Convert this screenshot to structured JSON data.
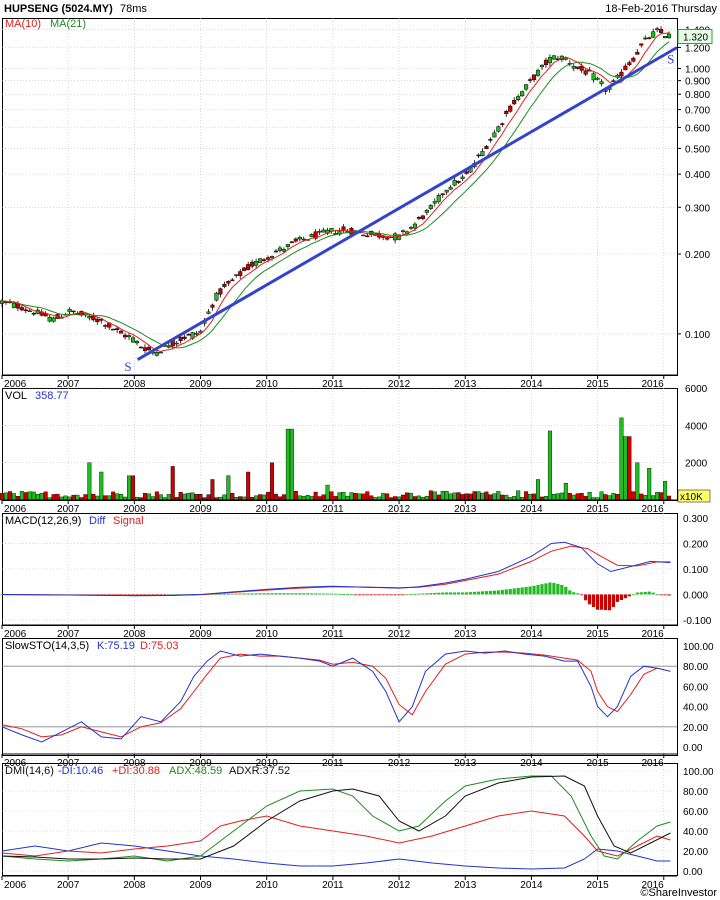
{
  "header": {
    "symbol": "HUPSENG (5024.MY)",
    "timing": "78ms",
    "date": "18-Feb-2016 Thursday",
    "copyright": "©ShareInvestor"
  },
  "colors": {
    "up": "#22bb22",
    "down": "#cc0000",
    "trendline": "#3344cc",
    "ma10": "#e02020",
    "ma21": "#208a20",
    "macd_diff": "#2233cc",
    "macd_signal": "#e02020",
    "sto_k": "#2233cc",
    "sto_d": "#e02020",
    "dmi_minus": "#2233cc",
    "dmi_plus": "#e02020",
    "adx": "#208a20",
    "adxr": "#111111",
    "grid": "#c0c0c0",
    "guide": "#888888"
  },
  "x_axis": {
    "year_labels": [
      "2006",
      "2007",
      "2008",
      "2009",
      "2010",
      "2011",
      "2012",
      "2013",
      "2014",
      "2015",
      "2016"
    ]
  },
  "chart_data": [
    {
      "type": "candlestick",
      "name": "price",
      "legend": [
        {
          "label": "MA(10)",
          "color": "#e02020"
        },
        {
          "label": "MA(21)",
          "color": "#208a20"
        }
      ],
      "y_scale": "log",
      "ylim": [
        0.07,
        1.55
      ],
      "y_ticks": [
        "0.100",
        "0.200",
        "0.300",
        "0.400",
        "0.500",
        "0.600",
        "0.700",
        "0.800",
        "0.900",
        "1.000",
        "1.200",
        "1.400"
      ],
      "last_price": "1.320",
      "trendline_labels": [
        "S",
        "S"
      ],
      "price_path": [
        [
          2006.0,
          0.132
        ],
        [
          2006.3,
          0.126
        ],
        [
          2006.6,
          0.118
        ],
        [
          2006.8,
          0.113
        ],
        [
          2007.0,
          0.122
        ],
        [
          2007.2,
          0.118
        ],
        [
          2007.5,
          0.112
        ],
        [
          2007.8,
          0.1
        ],
        [
          2007.95,
          0.097
        ],
        [
          2008.1,
          0.09
        ],
        [
          2008.3,
          0.085
        ],
        [
          2008.5,
          0.09
        ],
        [
          2008.75,
          0.097
        ],
        [
          2009.0,
          0.102
        ],
        [
          2009.25,
          0.14
        ],
        [
          2009.5,
          0.16
        ],
        [
          2009.75,
          0.18
        ],
        [
          2010.0,
          0.195
        ],
        [
          2010.25,
          0.21
        ],
        [
          2010.5,
          0.225
        ],
        [
          2010.75,
          0.235
        ],
        [
          2011.0,
          0.245
        ],
        [
          2011.25,
          0.245
        ],
        [
          2011.5,
          0.238
        ],
        [
          2011.75,
          0.235
        ],
        [
          2012.0,
          0.232
        ],
        [
          2012.25,
          0.26
        ],
        [
          2012.5,
          0.3
        ],
        [
          2012.75,
          0.36
        ],
        [
          2013.0,
          0.39
        ],
        [
          2013.25,
          0.48
        ],
        [
          2013.5,
          0.6
        ],
        [
          2013.75,
          0.75
        ],
        [
          2014.0,
          0.9
        ],
        [
          2014.15,
          1.0
        ],
        [
          2014.3,
          1.1
        ],
        [
          2014.5,
          1.1
        ],
        [
          2014.7,
          1.0
        ],
        [
          2014.9,
          0.95
        ],
        [
          2015.0,
          0.9
        ],
        [
          2015.15,
          0.82
        ],
        [
          2015.35,
          0.95
        ],
        [
          2015.55,
          1.1
        ],
        [
          2015.75,
          1.3
        ],
        [
          2015.9,
          1.38
        ],
        [
          2016.1,
          1.32
        ]
      ]
    },
    {
      "type": "bar",
      "name": "volume",
      "legend_label": "VOL",
      "legend_value": "358.77",
      "unit": "x10K",
      "ylim": [
        0,
        6000
      ],
      "y_ticks": [
        "6000",
        "4000",
        "2000"
      ],
      "spikes": [
        [
          2007.3,
          2000
        ],
        [
          2007.5,
          1500
        ],
        [
          2007.95,
          1300
        ],
        [
          2008.6,
          1800
        ],
        [
          2009.2,
          1100
        ],
        [
          2009.4,
          1300
        ],
        [
          2009.7,
          1500
        ],
        [
          2010.1,
          2000
        ],
        [
          2010.35,
          3800
        ],
        [
          2010.9,
          800
        ],
        [
          2011.3,
          400
        ],
        [
          2012.5,
          500
        ],
        [
          2013.2,
          450
        ],
        [
          2013.8,
          500
        ],
        [
          2014.1,
          1100
        ],
        [
          2014.3,
          3700
        ],
        [
          2014.5,
          900
        ],
        [
          2015.35,
          4400
        ],
        [
          2015.45,
          3400
        ],
        [
          2015.6,
          2000
        ],
        [
          2015.8,
          1700
        ],
        [
          2016.0,
          1000
        ]
      ],
      "base_level": 250
    },
    {
      "type": "line",
      "name": "MACD(12,26,9)",
      "legend": [
        {
          "label": "MACD(12,26,9)",
          "color": "#111111"
        },
        {
          "label": "Diff",
          "color": "#2233cc"
        },
        {
          "label": "Signal",
          "color": "#e02020"
        }
      ],
      "ylim": [
        -0.12,
        0.32
      ],
      "y_ticks": [
        "0.300",
        "0.200",
        "0.100",
        "0.000",
        "-0.100"
      ],
      "diff": [
        [
          2006.0,
          0.0
        ],
        [
          2007.0,
          -0.002
        ],
        [
          2008.0,
          -0.005
        ],
        [
          2008.5,
          -0.004
        ],
        [
          2009.0,
          0.0
        ],
        [
          2009.5,
          0.01
        ],
        [
          2010.0,
          0.02
        ],
        [
          2010.5,
          0.028
        ],
        [
          2011.0,
          0.032
        ],
        [
          2011.5,
          0.028
        ],
        [
          2012.0,
          0.025
        ],
        [
          2012.3,
          0.03
        ],
        [
          2012.7,
          0.045
        ],
        [
          2013.0,
          0.06
        ],
        [
          2013.5,
          0.09
        ],
        [
          2014.0,
          0.15
        ],
        [
          2014.3,
          0.2
        ],
        [
          2014.5,
          0.205
        ],
        [
          2014.75,
          0.185
        ],
        [
          2015.0,
          0.12
        ],
        [
          2015.2,
          0.09
        ],
        [
          2015.5,
          0.11
        ],
        [
          2015.8,
          0.13
        ],
        [
          2016.1,
          0.125
        ]
      ],
      "signal": [
        [
          2006.0,
          0.0
        ],
        [
          2007.0,
          -0.002
        ],
        [
          2008.0,
          -0.004
        ],
        [
          2008.5,
          -0.004
        ],
        [
          2009.0,
          -0.001
        ],
        [
          2009.5,
          0.008
        ],
        [
          2010.0,
          0.017
        ],
        [
          2010.5,
          0.025
        ],
        [
          2011.0,
          0.03
        ],
        [
          2011.5,
          0.029
        ],
        [
          2012.0,
          0.026
        ],
        [
          2012.3,
          0.028
        ],
        [
          2012.7,
          0.04
        ],
        [
          2013.0,
          0.055
        ],
        [
          2013.5,
          0.08
        ],
        [
          2014.0,
          0.13
        ],
        [
          2014.3,
          0.17
        ],
        [
          2014.6,
          0.19
        ],
        [
          2014.85,
          0.18
        ],
        [
          2015.05,
          0.15
        ],
        [
          2015.3,
          0.115
        ],
        [
          2015.6,
          0.112
        ],
        [
          2015.9,
          0.128
        ],
        [
          2016.1,
          0.128
        ]
      ]
    },
    {
      "type": "line",
      "name": "SlowSTO(14,3,5)",
      "legend": [
        {
          "label": "SlowSTO(14,3,5)",
          "color": "#111111"
        },
        {
          "label": "K:75.19",
          "color": "#2233cc"
        },
        {
          "label": "D:75.03",
          "color": "#e02020"
        }
      ],
      "ylim": [
        0,
        100
      ],
      "y_ticks": [
        "100.00",
        "80.00",
        "60.00",
        "40.00",
        "20.00",
        "0.00"
      ],
      "guide_levels": [
        80,
        20
      ],
      "k": [
        [
          2006.0,
          20
        ],
        [
          2006.3,
          12
        ],
        [
          2006.6,
          5
        ],
        [
          2006.9,
          15
        ],
        [
          2007.2,
          25
        ],
        [
          2007.5,
          10
        ],
        [
          2007.8,
          8
        ],
        [
          2008.1,
          30
        ],
        [
          2008.4,
          25
        ],
        [
          2008.7,
          45
        ],
        [
          2008.9,
          70
        ],
        [
          2009.1,
          85
        ],
        [
          2009.3,
          95
        ],
        [
          2009.6,
          90
        ],
        [
          2009.9,
          92
        ],
        [
          2010.2,
          90
        ],
        [
          2010.5,
          88
        ],
        [
          2010.8,
          85
        ],
        [
          2011.0,
          80
        ],
        [
          2011.3,
          88
        ],
        [
          2011.6,
          75
        ],
        [
          2011.8,
          55
        ],
        [
          2012.0,
          25
        ],
        [
          2012.2,
          40
        ],
        [
          2012.4,
          75
        ],
        [
          2012.7,
          92
        ],
        [
          2013.0,
          95
        ],
        [
          2013.3,
          93
        ],
        [
          2013.6,
          95
        ],
        [
          2013.9,
          92
        ],
        [
          2014.2,
          90
        ],
        [
          2014.5,
          85
        ],
        [
          2014.7,
          85
        ],
        [
          2014.9,
          60
        ],
        [
          2015.0,
          40
        ],
        [
          2015.15,
          30
        ],
        [
          2015.3,
          40
        ],
        [
          2015.5,
          70
        ],
        [
          2015.7,
          80
        ],
        [
          2015.9,
          78
        ],
        [
          2016.1,
          75
        ]
      ],
      "d": [
        [
          2006.0,
          22
        ],
        [
          2006.3,
          18
        ],
        [
          2006.6,
          10
        ],
        [
          2006.9,
          12
        ],
        [
          2007.2,
          20
        ],
        [
          2007.5,
          15
        ],
        [
          2007.8,
          10
        ],
        [
          2008.1,
          20
        ],
        [
          2008.4,
          24
        ],
        [
          2008.7,
          38
        ],
        [
          2008.9,
          55
        ],
        [
          2009.1,
          72
        ],
        [
          2009.3,
          88
        ],
        [
          2009.6,
          92
        ],
        [
          2009.9,
          90
        ],
        [
          2010.2,
          90
        ],
        [
          2010.5,
          88
        ],
        [
          2010.8,
          86
        ],
        [
          2011.0,
          82
        ],
        [
          2011.3,
          84
        ],
        [
          2011.6,
          80
        ],
        [
          2011.8,
          68
        ],
        [
          2012.0,
          42
        ],
        [
          2012.2,
          32
        ],
        [
          2012.4,
          55
        ],
        [
          2012.7,
          82
        ],
        [
          2013.0,
          92
        ],
        [
          2013.3,
          94
        ],
        [
          2013.6,
          94
        ],
        [
          2013.9,
          93
        ],
        [
          2014.2,
          91
        ],
        [
          2014.5,
          88
        ],
        [
          2014.7,
          86
        ],
        [
          2014.9,
          75
        ],
        [
          2015.0,
          55
        ],
        [
          2015.15,
          40
        ],
        [
          2015.3,
          35
        ],
        [
          2015.5,
          52
        ],
        [
          2015.7,
          72
        ],
        [
          2015.9,
          78
        ],
        [
          2016.1,
          75
        ]
      ]
    },
    {
      "type": "line",
      "name": "DMI(14,6)",
      "legend": [
        {
          "label": "DMI(14,6)",
          "color": "#111111"
        },
        {
          "label": "-DI:10.46",
          "color": "#2233cc"
        },
        {
          "label": "+DI:30.88",
          "color": "#e02020"
        },
        {
          "label": "ADX:48.59",
          "color": "#208a20"
        },
        {
          "label": "ADXR:37.52",
          "color": "#111111"
        }
      ],
      "ylim": [
        0,
        100
      ],
      "y_ticks": [
        "100.00",
        "80.00",
        "60.00",
        "40.00",
        "20.00",
        "0.00"
      ],
      "minus_di": [
        [
          2006.0,
          20
        ],
        [
          2006.5,
          25
        ],
        [
          2007.0,
          20
        ],
        [
          2007.5,
          28
        ],
        [
          2008.0,
          25
        ],
        [
          2008.5,
          20
        ],
        [
          2009.0,
          15
        ],
        [
          2009.5,
          12
        ],
        [
          2010.0,
          8
        ],
        [
          2010.5,
          5
        ],
        [
          2011.0,
          5
        ],
        [
          2011.5,
          8
        ],
        [
          2012.0,
          12
        ],
        [
          2012.5,
          8
        ],
        [
          2013.0,
          5
        ],
        [
          2013.5,
          3
        ],
        [
          2014.0,
          2
        ],
        [
          2014.5,
          3
        ],
        [
          2014.8,
          12
        ],
        [
          2015.0,
          22
        ],
        [
          2015.3,
          20
        ],
        [
          2015.6,
          15
        ],
        [
          2015.9,
          10
        ],
        [
          2016.1,
          10
        ]
      ],
      "plus_di": [
        [
          2006.0,
          18
        ],
        [
          2006.5,
          15
        ],
        [
          2007.0,
          20
        ],
        [
          2007.5,
          18
        ],
        [
          2008.0,
          22
        ],
        [
          2008.5,
          25
        ],
        [
          2009.0,
          30
        ],
        [
          2009.3,
          45
        ],
        [
          2009.6,
          50
        ],
        [
          2010.0,
          55
        ],
        [
          2010.5,
          45
        ],
        [
          2011.0,
          40
        ],
        [
          2011.5,
          35
        ],
        [
          2012.0,
          28
        ],
        [
          2012.5,
          35
        ],
        [
          2013.0,
          45
        ],
        [
          2013.5,
          55
        ],
        [
          2014.0,
          60
        ],
        [
          2014.5,
          55
        ],
        [
          2014.8,
          35
        ],
        [
          2015.0,
          20
        ],
        [
          2015.3,
          15
        ],
        [
          2015.6,
          25
        ],
        [
          2015.9,
          35
        ],
        [
          2016.1,
          31
        ]
      ],
      "adx": [
        [
          2006.0,
          15
        ],
        [
          2006.5,
          12
        ],
        [
          2007.0,
          10
        ],
        [
          2007.5,
          12
        ],
        [
          2008.0,
          15
        ],
        [
          2008.5,
          10
        ],
        [
          2009.0,
          15
        ],
        [
          2009.5,
          40
        ],
        [
          2010.0,
          65
        ],
        [
          2010.5,
          80
        ],
        [
          2011.0,
          82
        ],
        [
          2011.3,
          75
        ],
        [
          2011.6,
          55
        ],
        [
          2012.0,
          40
        ],
        [
          2012.3,
          45
        ],
        [
          2012.7,
          70
        ],
        [
          2013.0,
          85
        ],
        [
          2013.5,
          92
        ],
        [
          2014.0,
          95
        ],
        [
          2014.3,
          95
        ],
        [
          2014.6,
          75
        ],
        [
          2014.9,
          35
        ],
        [
          2015.1,
          15
        ],
        [
          2015.3,
          12
        ],
        [
          2015.6,
          30
        ],
        [
          2015.9,
          45
        ],
        [
          2016.1,
          49
        ]
      ],
      "adxr": [
        [
          2006.0,
          15
        ],
        [
          2006.5,
          14
        ],
        [
          2007.0,
          12
        ],
        [
          2007.5,
          12
        ],
        [
          2008.0,
          13
        ],
        [
          2008.5,
          12
        ],
        [
          2009.0,
          12
        ],
        [
          2009.5,
          25
        ],
        [
          2010.0,
          50
        ],
        [
          2010.5,
          70
        ],
        [
          2011.0,
          80
        ],
        [
          2011.3,
          82
        ],
        [
          2011.7,
          75
        ],
        [
          2012.0,
          50
        ],
        [
          2012.3,
          40
        ],
        [
          2012.7,
          55
        ],
        [
          2013.0,
          75
        ],
        [
          2013.5,
          88
        ],
        [
          2014.0,
          94
        ],
        [
          2014.5,
          95
        ],
        [
          2014.8,
          85
        ],
        [
          2015.0,
          55
        ],
        [
          2015.25,
          25
        ],
        [
          2015.5,
          18
        ],
        [
          2015.8,
          28
        ],
        [
          2016.1,
          38
        ]
      ]
    }
  ]
}
